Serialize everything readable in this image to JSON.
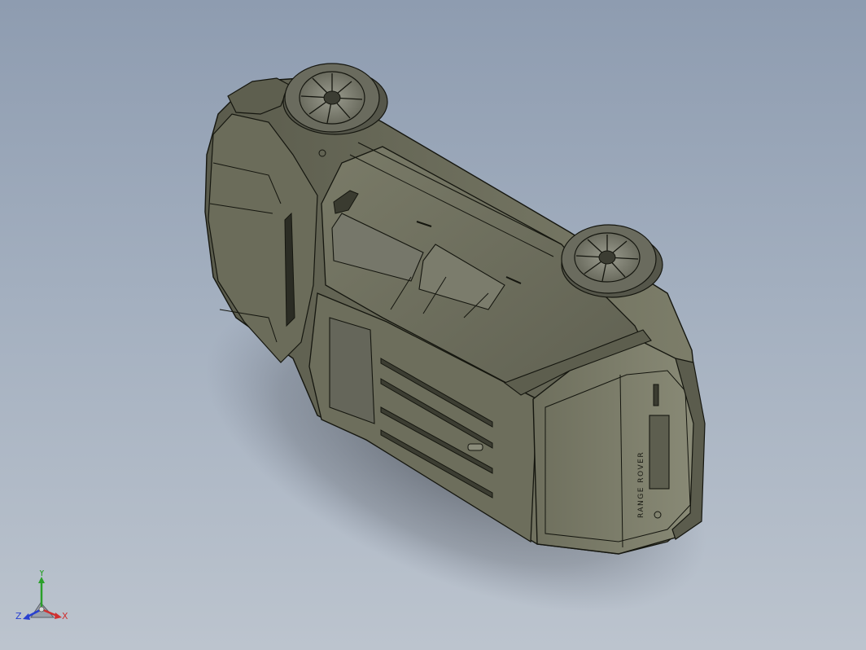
{
  "viewport": {
    "background_top": "#8e9cb0",
    "background_bottom": "#bcc4ce"
  },
  "model": {
    "body_color": "#6f705f",
    "body_highlight": "#878874",
    "body_shadow": "#4a4b3f",
    "edge_color": "#15160f",
    "tire_color": "#5c5d50",
    "rim_color": "#8c8d80",
    "tailgate_lettering": "RANGE ROVER"
  },
  "triad": {
    "x_label": "X",
    "y_label": "Y",
    "z_label": "Z",
    "x_color": "#d03030",
    "y_color": "#2aa02a",
    "z_color": "#2840d0"
  }
}
